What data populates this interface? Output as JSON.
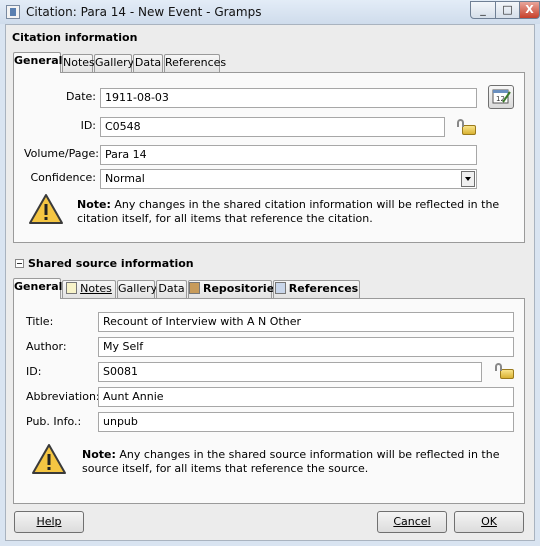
{
  "window": {
    "title": "Citation: Para 14 - New Event - Gramps",
    "minimize_glyph": "_",
    "maximize_glyph": "□",
    "close_glyph": "X"
  },
  "citation": {
    "section_title": "Citation information",
    "tabs": [
      "General",
      "Notes",
      "Gallery",
      "Data",
      "References"
    ],
    "date_label": "Date:",
    "date_value": "1911-08-03",
    "id_label": "ID:",
    "id_value": "C0548",
    "volume_label": "Volume/Page:",
    "volume_value": "Para 14",
    "confidence_label": "Confidence:",
    "confidence_value": "Normal",
    "note_prefix": "Note:",
    "note_text": " Any changes in the shared citation information will be reflected in the citation itself, for all items that reference the citation."
  },
  "source": {
    "section_title": "Shared source information",
    "tabs": [
      "General",
      "Notes",
      "Gallery",
      "Data",
      "Repositories",
      "References"
    ],
    "title_label": "Title:",
    "title_value": "Recount of Interview with A N Other",
    "author_label": "Author:",
    "author_value": "My Self",
    "id_label": "ID:",
    "id_value": "S0081",
    "abbrev_label": "Abbreviation:",
    "abbrev_value": "Aunt Annie",
    "pubinfo_label": "Pub. Info.:",
    "pubinfo_value": "unpub",
    "note_prefix": "Note:",
    "note_text": " Any changes in the shared source information will be reflected in the source itself, for all items that reference the source."
  },
  "buttons": {
    "help": "Help",
    "cancel": "Cancel",
    "ok": "OK"
  },
  "icons": {
    "window": "gramps-app-icon",
    "date_editor": "date-editor-icon",
    "lock": "padlock-icon",
    "warning": "warning-triangle-icon"
  }
}
